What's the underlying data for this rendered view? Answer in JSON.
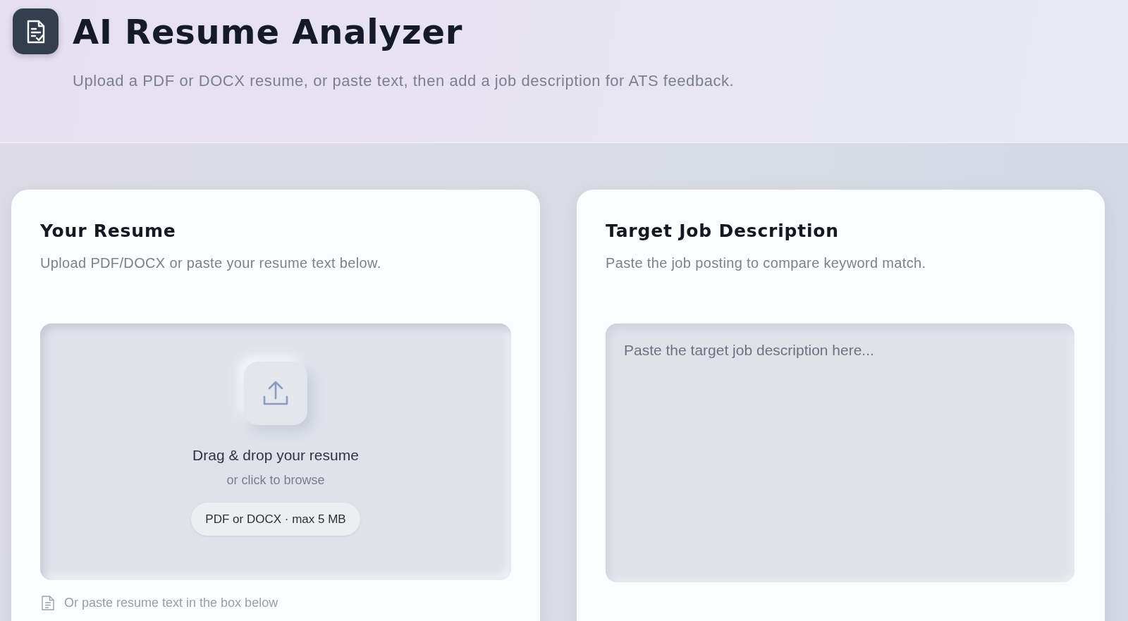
{
  "header": {
    "title": "AI Resume Analyzer",
    "subtitle": "Upload a PDF or DOCX resume, or paste text, then add a job description for ATS feedback."
  },
  "resume_card": {
    "title": "Your Resume",
    "description": "Upload PDF/DOCX or paste your resume text below.",
    "dropzone": {
      "title": "Drag & drop your resume",
      "hint": "or click to browse",
      "formats": "PDF or DOCX · max 5 MB"
    },
    "paste_hint": "Or paste resume text in the box below"
  },
  "job_card": {
    "title": "Target Job Description",
    "description": "Paste the job posting to compare keyword match.",
    "textarea": {
      "placeholder": "Paste the target job description here..."
    }
  }
}
